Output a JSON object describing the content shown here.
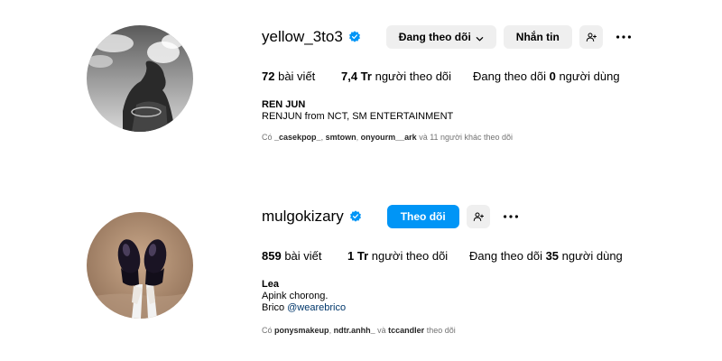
{
  "profiles": [
    {
      "username": "yellow_3to3",
      "buttons": {
        "following": "Đang theo dõi",
        "message": "Nhắn tin"
      },
      "stats": {
        "posts_count": "72",
        "posts_label": "bài viết",
        "followers_count": "7,4 Tr",
        "followers_label": "người theo dõi",
        "following_prefix": "Đang theo dõi",
        "following_count": "0",
        "following_suffix": "người dùng"
      },
      "bio": {
        "name": "REN JUN",
        "line1": "RENJUN from NCT, SM ENTERTAINMENT"
      },
      "followed_by": {
        "prefix": "Có",
        "user1": "_casekpop_",
        "sep1": ",",
        "user2": "smtown",
        "sep2": ",",
        "user3": "onyourm__ark",
        "suffix": "và 11 người khác theo dõi"
      }
    },
    {
      "username": "mulgokizary",
      "buttons": {
        "follow": "Theo dõi"
      },
      "stats": {
        "posts_count": "859",
        "posts_label": "bài viết",
        "followers_count": "1 Tr",
        "followers_label": "người theo dõi",
        "following_prefix": "Đang theo dõi",
        "following_count": "35",
        "following_suffix": "người dùng"
      },
      "bio": {
        "name": "Lea",
        "line1": "Apink chorong.",
        "line2_prefix": "Brico",
        "line2_link": "@wearebrico"
      },
      "followed_by": {
        "prefix": "Có",
        "user1": "ponysmakeup",
        "sep1": ",",
        "user2": "ndtr.anhh_",
        "mid": "và",
        "user3": "tccandler",
        "suffix": "theo dõi"
      }
    }
  ],
  "icons": {
    "verified": "verified-badge-icon",
    "dropdown": "chevron-down-icon",
    "suggest": "add-person-icon",
    "more": "more-options-icon"
  },
  "colors": {
    "primary_button": "#0095f6",
    "secondary_button": "#efefef",
    "verified_badge": "#0095f6",
    "link": "#00376b",
    "muted_text": "#737373"
  }
}
